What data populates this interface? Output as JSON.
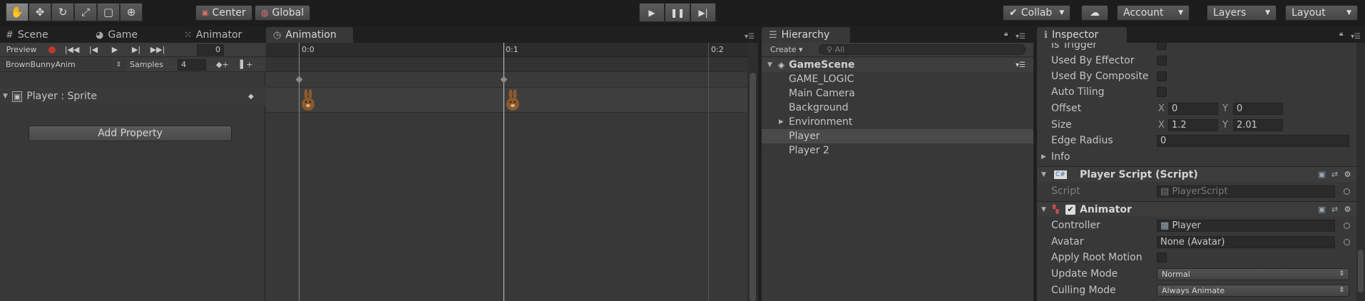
{
  "toolbar": {
    "transform_tools": [
      "hand-icon",
      "move-icon",
      "rotate-icon",
      "scale-icon",
      "rect-icon",
      "transform-icon"
    ],
    "pivot_label": "Center",
    "space_label": "Global",
    "collab_label": "Collab",
    "account_label": "Account",
    "layers_label": "Layers",
    "layout_label": "Layout"
  },
  "tabs_left": {
    "scene": "Scene",
    "game": "Game",
    "animator": "Animator",
    "animation": "Animation"
  },
  "animation": {
    "preview_label": "Preview",
    "frame_value": "0",
    "clip_name": "BrownBunnyAnim",
    "samples_label": "Samples",
    "samples_value": "4",
    "property_label": "Player : Sprite",
    "add_property_label": "Add Property",
    "ruler_labels": [
      "0:0",
      "0:1",
      "0:2"
    ],
    "keyframe_times": [
      "0:0",
      "0:1"
    ],
    "current_time": "0:1"
  },
  "hierarchy": {
    "tab_label": "Hierarchy",
    "create_label": "Create",
    "search_placeholder": "All",
    "scene_name": "GameScene",
    "items": [
      {
        "label": "GAME_LOGIC"
      },
      {
        "label": "Main Camera"
      },
      {
        "label": "Background"
      },
      {
        "label": "Environment"
      },
      {
        "label": "Player"
      },
      {
        "label": "Player 2"
      }
    ],
    "selected": "Player"
  },
  "inspector": {
    "tab_label": "Inspector",
    "is_trigger_label": "Is Trigger",
    "used_by_effector_label": "Used By Effector",
    "used_by_composite_label": "Used By Composite",
    "auto_tiling_label": "Auto Tiling",
    "offset_label": "Offset",
    "offset_x": "0",
    "offset_y": "0",
    "size_label": "Size",
    "size_x": "1.2",
    "size_y": "2.01",
    "edge_radius_label": "Edge Radius",
    "edge_radius_value": "0",
    "info_label": "Info",
    "axis_x": "X",
    "axis_y": "Y",
    "player_script_title": "Player Script (Script)",
    "script_label": "Script",
    "script_value": "PlayerScript",
    "animator_title": "Animator",
    "controller_label": "Controller",
    "controller_value": "Player",
    "avatar_label": "Avatar",
    "avatar_value": "None (Avatar)",
    "apply_root_motion_label": "Apply Root Motion",
    "update_mode_label": "Update Mode",
    "update_mode_value": "Normal",
    "culling_mode_label": "Culling Mode",
    "culling_mode_value": "Always Animate"
  },
  "colors": {
    "panel_bg": "#383838",
    "toolbar_bg": "#1c1c1c",
    "record_red": "#c0392b",
    "bunny_brown": "#8b5a2b"
  }
}
